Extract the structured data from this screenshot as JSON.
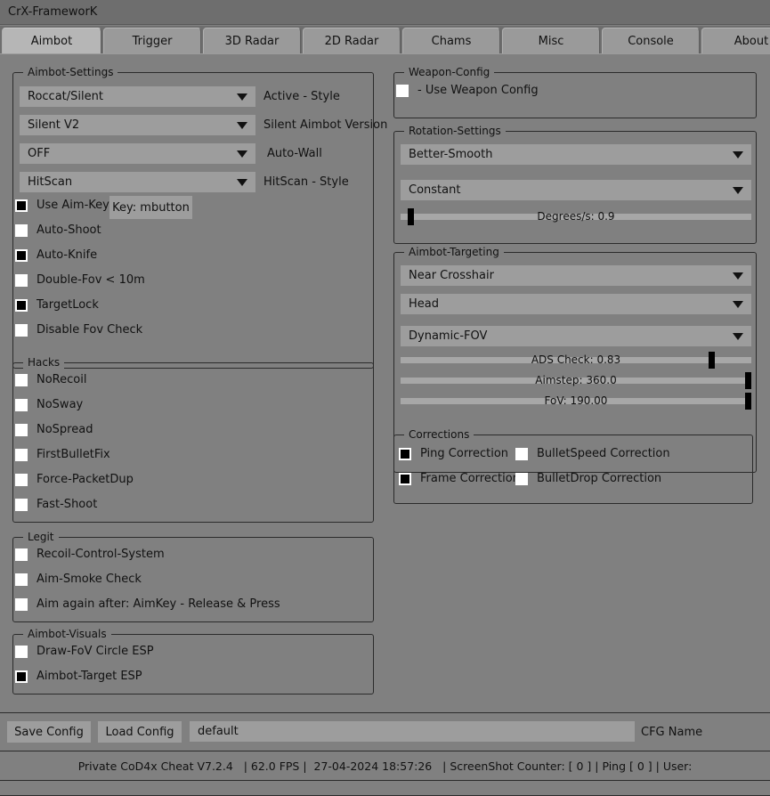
{
  "window": {
    "title": "CrX-FrameworK"
  },
  "tabs": [
    {
      "label": "Aimbot",
      "active": true
    },
    {
      "label": "Trigger",
      "active": false
    },
    {
      "label": "3D Radar",
      "active": false
    },
    {
      "label": "2D Radar",
      "active": false
    },
    {
      "label": "Chams",
      "active": false
    },
    {
      "label": "Misc",
      "active": false
    },
    {
      "label": "Console",
      "active": false
    },
    {
      "label": "About",
      "active": false
    }
  ],
  "aimbot_settings": {
    "legend": "Aimbot-Settings",
    "combos": [
      {
        "value": "Roccat/Silent",
        "side_label": "Active - Style"
      },
      {
        "value": "Silent V2",
        "side_label": "Silent Aimbot Version"
      },
      {
        "value": "OFF",
        "side_label": "Auto-Wall"
      },
      {
        "value": "HitScan",
        "side_label": "HitScan - Style"
      }
    ],
    "aim_key_checkbox": {
      "label": "Use Aim-Key",
      "checked": true
    },
    "aim_key_button": "Key: mbutton",
    "checkboxes": [
      {
        "label": "Auto-Shoot",
        "checked": false
      },
      {
        "label": "Auto-Knife",
        "checked": true
      },
      {
        "label": "Double-Fov  < 10m",
        "checked": false
      },
      {
        "label": "TargetLock",
        "checked": true
      },
      {
        "label": "Disable Fov Check",
        "checked": false
      }
    ]
  },
  "hacks": {
    "legend": "Hacks",
    "checkboxes": [
      {
        "label": "NoRecoil",
        "checked": false
      },
      {
        "label": "NoSway",
        "checked": false
      },
      {
        "label": "NoSpread",
        "checked": false
      },
      {
        "label": "FirstBulletFix",
        "checked": false
      },
      {
        "label": "Force-PacketDup",
        "checked": false
      },
      {
        "label": "Fast-Shoot",
        "checked": false
      }
    ]
  },
  "legit": {
    "legend": "Legit",
    "checkboxes": [
      {
        "label": "Recoil-Control-System",
        "checked": false
      },
      {
        "label": "Aim-Smoke Check",
        "checked": false
      },
      {
        "label": "Aim again after: AimKey - Release & Press",
        "checked": false
      }
    ]
  },
  "aimbot_visuals": {
    "legend": "Aimbot-Visuals",
    "checkboxes": [
      {
        "label": "Draw-FoV Circle ESP",
        "checked": false
      },
      {
        "label": "Aimbot-Target ESP",
        "checked": true
      }
    ]
  },
  "weapon_config": {
    "legend": "Weapon-Config",
    "checkboxes": [
      {
        "label": "- Use Weapon Config",
        "checked": false
      }
    ]
  },
  "rotation_settings": {
    "legend": "Rotation-Settings",
    "combos": [
      {
        "value": "Better-Smooth"
      },
      {
        "value": "Constant"
      }
    ],
    "sliders": [
      {
        "label": "Degrees/s: 0.9",
        "value": 0.9,
        "percent": 2
      }
    ]
  },
  "aimbot_targeting": {
    "legend": "Aimbot-Targeting",
    "combos": [
      {
        "value": "Near Crosshair"
      },
      {
        "value": "Head"
      },
      {
        "value": "Dynamic-FOV"
      }
    ],
    "sliders": [
      {
        "label": "ADS Check: 0.83",
        "value": 0.83,
        "percent": 85
      },
      {
        "label": "Aimstep: 360.0",
        "value": 360.0,
        "percent": 98
      },
      {
        "label": "FoV: 190.00",
        "value": 190.0,
        "percent": 98
      }
    ]
  },
  "corrections": {
    "legend": "Corrections",
    "checkboxes_left": [
      {
        "label": "Ping Correction",
        "checked": true
      },
      {
        "label": "Frame Correction",
        "checked": true
      }
    ],
    "checkboxes_right": [
      {
        "label": "BulletSpeed Correction",
        "checked": false
      },
      {
        "label": "BulletDrop Correction",
        "checked": false
      }
    ]
  },
  "config_bar": {
    "save_label": "Save Config",
    "load_label": "Load Config",
    "cfg_value": "default",
    "cfg_placeholder": "default",
    "cfg_name_label": "CFG Name"
  },
  "status_bar": {
    "text": "Private CoD4x Cheat V7.2.4   | 62.0 FPS |  27-04-2024 18:57:26   | ScreenShot Counter: [ 0 ] | Ping [ 0 ] | User:"
  },
  "colors": {
    "window_bg": "#808080",
    "titlebar_bg": "#6e6e6e",
    "control_bg": "#9d9d9d",
    "tab_active_bg": "#b6b6b6",
    "tab_inactive_bg": "#9a9a9a",
    "border": "#2b2b2b",
    "text": "#111111",
    "checkbox_on": "#000000",
    "checkbox_off": "#ffffff",
    "slider_track": "#a7a7a7"
  }
}
